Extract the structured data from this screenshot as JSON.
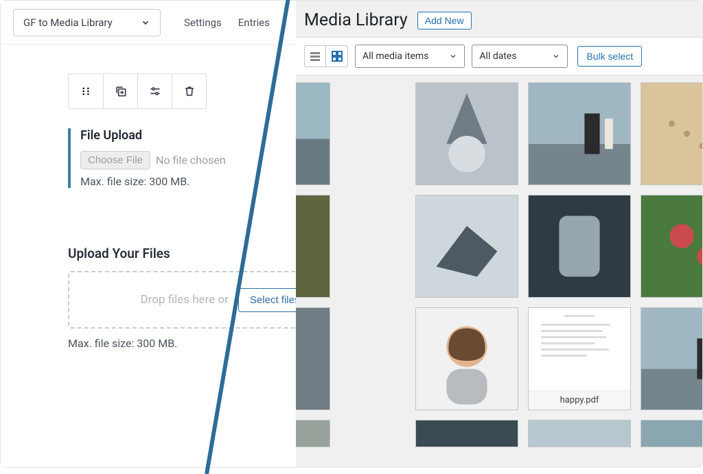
{
  "left": {
    "form_selector": "GF to Media Library",
    "nav": {
      "settings": "Settings",
      "entries": "Entries"
    },
    "file_field": {
      "title": "File Upload",
      "choose_btn": "Choose File",
      "no_file": "No file chosen",
      "max_size": "Max. file size: 300 MB."
    },
    "multi_field": {
      "title": "Upload Your Files",
      "drop_text": "Drop files here or",
      "select_btn": "Select files",
      "max_size": "Max. file size: 300 MB."
    }
  },
  "right": {
    "title": "Media Library",
    "add_new": "Add New",
    "filter_type": "All media items",
    "filter_date": "All dates",
    "bulk_select": "Bulk select",
    "doc_name": "happy.pdf"
  }
}
